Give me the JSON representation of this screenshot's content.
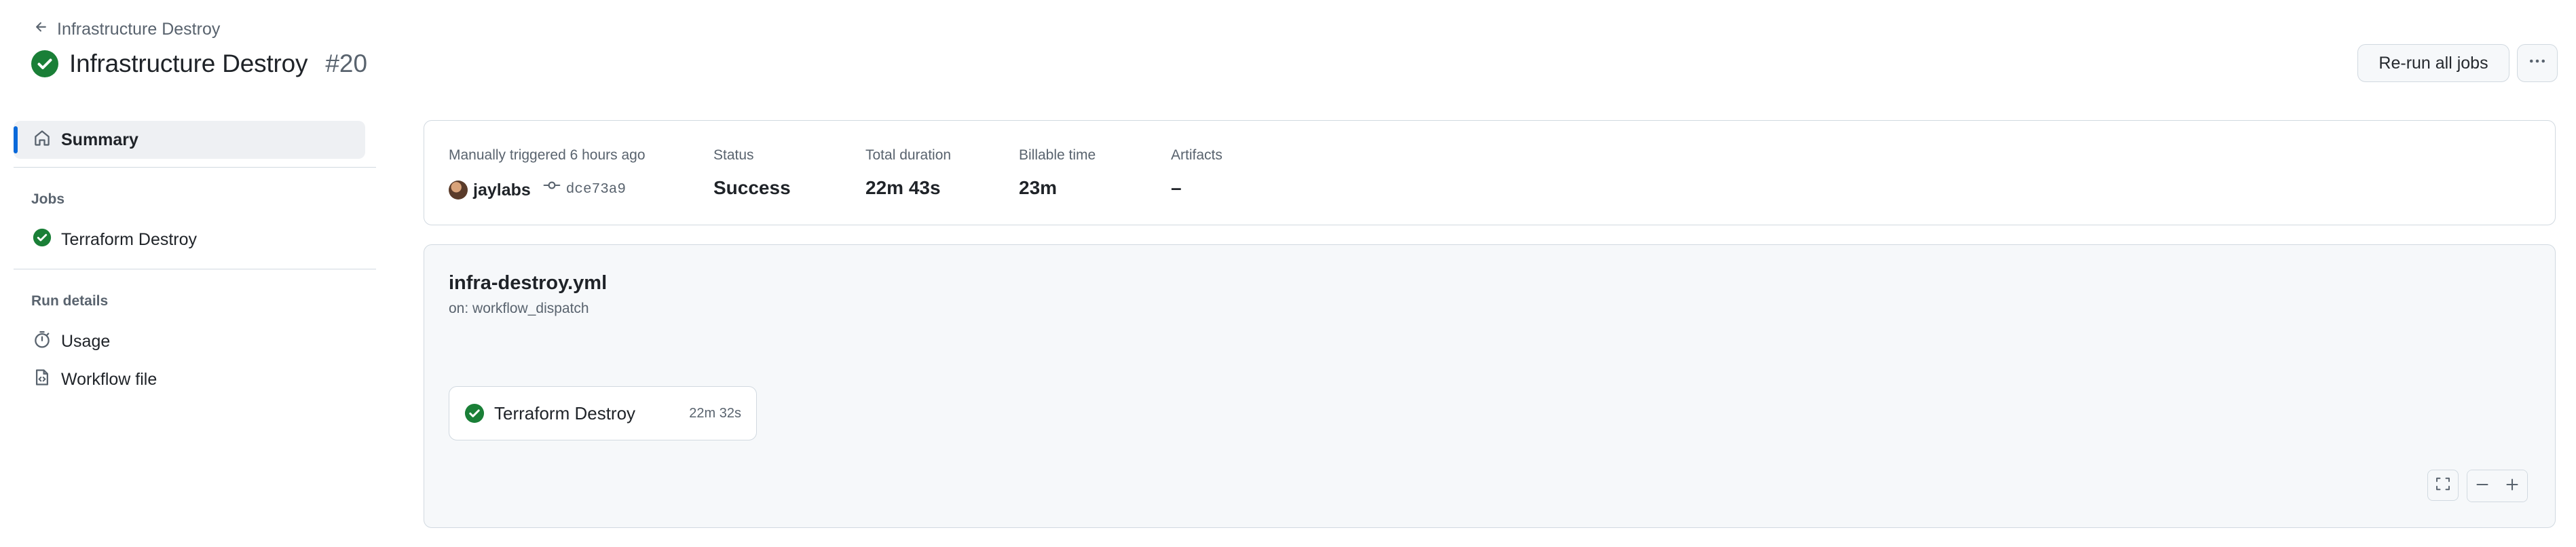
{
  "header": {
    "back_label": "Infrastructure Destroy",
    "title": "Infrastructure Destroy",
    "run_number": "#20",
    "status": "success",
    "rerun_label": "Re-run all jobs"
  },
  "sidebar": {
    "summary_label": "Summary",
    "jobs_heading": "Jobs",
    "jobs": [
      {
        "label": "Terraform Destroy",
        "status": "success"
      }
    ],
    "run_details_heading": "Run details",
    "usage_label": "Usage",
    "workflow_file_label": "Workflow file"
  },
  "summary": {
    "trigger_label": "Manually triggered 6 hours ago",
    "actor": "jaylabs",
    "commit": "dce73a9",
    "status_label": "Status",
    "status_value": "Success",
    "duration_label": "Total duration",
    "duration_value": "22m 43s",
    "billable_label": "Billable time",
    "billable_value": "23m",
    "artifacts_label": "Artifacts",
    "artifacts_value": "–"
  },
  "workflow": {
    "file": "infra-destroy.yml",
    "trigger": "on: workflow_dispatch",
    "jobs": [
      {
        "name": "Terraform Destroy",
        "duration": "22m 32s",
        "status": "success"
      }
    ]
  },
  "colors": {
    "success": "#1a7f37",
    "accent": "#0969da",
    "muted": "#59636e",
    "border": "#d1d9e0"
  },
  "icons": {
    "back": "arrow-left-icon",
    "status": "check-circle-fill-icon",
    "more": "kebab-horizontal-icon",
    "summary": "home-icon",
    "usage": "stopwatch-icon",
    "workflow_file": "file-code-icon",
    "commit": "git-commit-icon",
    "fullscreen": "screen-full-icon",
    "zoom_out": "dash-icon",
    "zoom_in": "plus-icon"
  }
}
